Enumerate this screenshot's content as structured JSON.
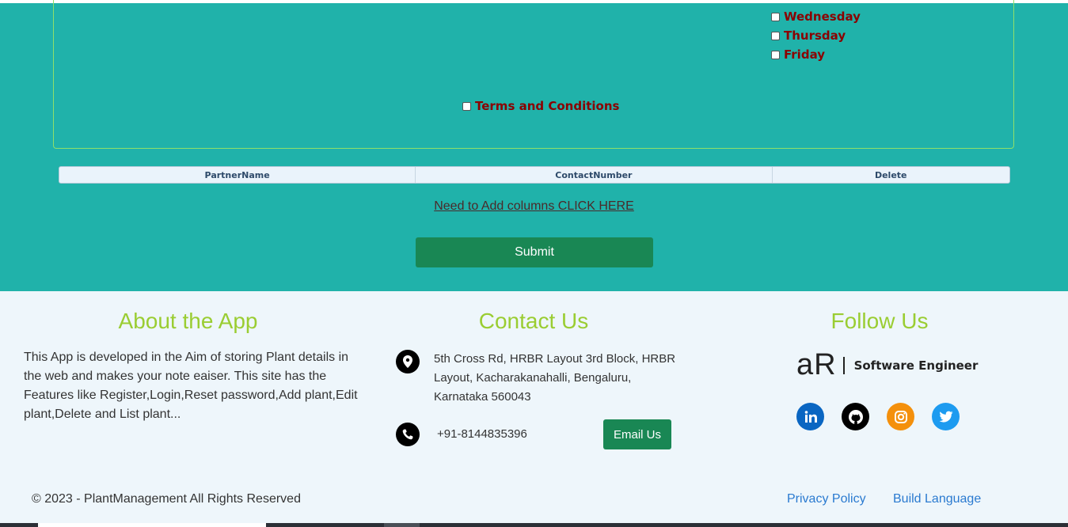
{
  "form": {
    "days": [
      "Wednesday",
      "Thursday",
      "Friday"
    ],
    "terms_label": "Terms and Conditions",
    "grid_headers": [
      "PartnerName",
      "ContactNumber",
      "Delete"
    ],
    "add_columns_link": "Need to Add columns CLICK HERE",
    "submit_label": "Submit"
  },
  "footer": {
    "about": {
      "title": "About the App",
      "text": "This App is developed in the Aim of storing Plant details in the web and makes your note eaiser. This site has the Features like Register,Login,Reset password,Add plant,Edit plant,Delete and List plant..."
    },
    "contact": {
      "title": "Contact Us",
      "address": "5th Cross Rd, HRBR Layout 3rd Block, HRBR Layout, Kacharakanahalli, Bengaluru, Karnataka 560043",
      "phone": "+91-8144835396",
      "email_button": "Email Us"
    },
    "follow": {
      "title": "Follow Us",
      "brand_logo": "aR",
      "brand_title": "Software Engineer",
      "socials": [
        {
          "icon": "linkedin-icon",
          "color": "#0a66c2"
        },
        {
          "icon": "github-icon",
          "color": "#000000"
        },
        {
          "icon": "instagram-icon",
          "color": "#f4900c"
        },
        {
          "icon": "twitter-icon",
          "color": "#1d9bf0"
        }
      ]
    },
    "copyright": "© 2023 - PlantManagement All Rights Reserved",
    "links": [
      "Privacy Policy",
      "Build Language"
    ]
  },
  "colors": {
    "teal_background": "#20b2aa",
    "accent_green": "#198754",
    "title_green": "#9acd32",
    "label_red": "#8b0000",
    "link_blue": "#2a7ad0"
  }
}
